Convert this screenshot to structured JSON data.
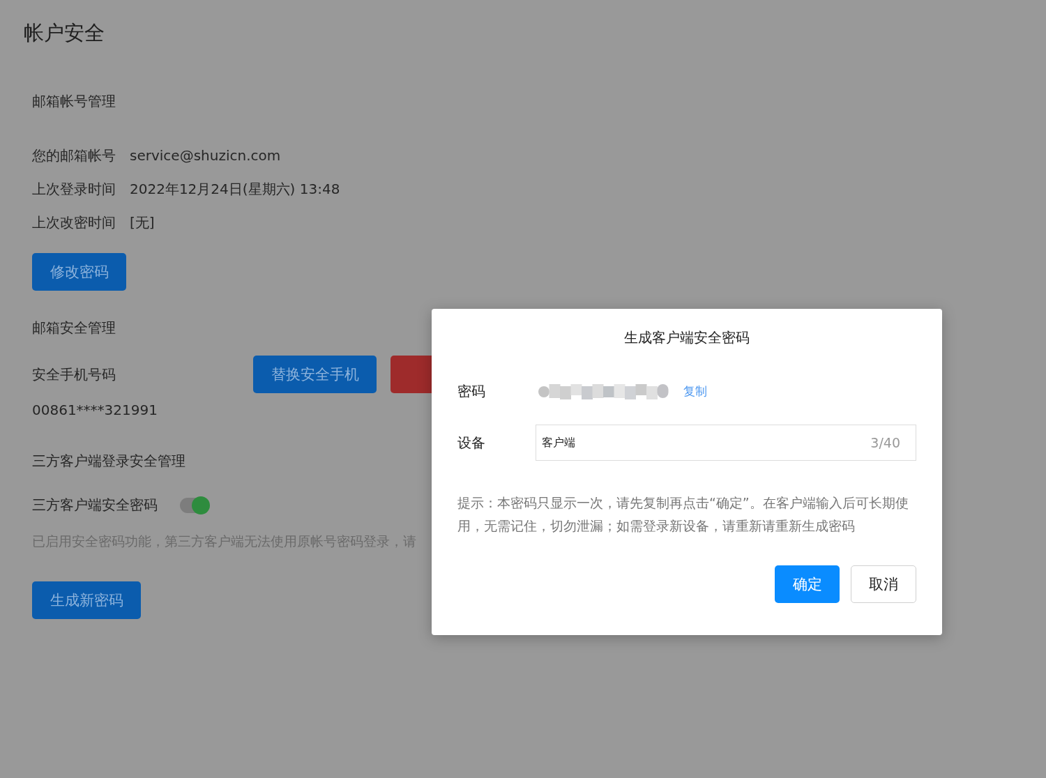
{
  "page": {
    "title": "帐户安全"
  },
  "mail_account": {
    "heading": "邮箱帐号管理",
    "fields": [
      {
        "label": "您的邮箱帐号",
        "value": "service@shuzicn.com"
      },
      {
        "label": "上次登录时间",
        "value": "2022年12月24日(星期六) 13:48"
      },
      {
        "label": "上次改密时间",
        "value": "[无]"
      }
    ],
    "button": "修改密码"
  },
  "mail_security": {
    "heading": "邮箱安全管理",
    "phone_label": "安全手机号码",
    "phone": "00861****321991",
    "replace_button": "替换安全手机"
  },
  "client_security": {
    "heading": "三方客户端登录安全管理",
    "toggle_label": "三方客户端安全密码",
    "toggle_on": true,
    "note": "已启用安全密码功能，第三方客户端无法使用原帐号密码登录，请",
    "button": "生成新密码"
  },
  "dialog": {
    "title": "生成客户端安全密码",
    "password_label": "密码",
    "copy_link": "复制",
    "device_label": "设备",
    "device_value": "客户端",
    "device_count": "3/40",
    "hint": "提示：本密码只显示一次，请先复制再点击“确定”。在客户端输入后可长期使用，无需记住，切勿泄漏；如需登录新设备，请重新请重新生成密码",
    "ok_button": "确定",
    "cancel_button": "取消"
  }
}
